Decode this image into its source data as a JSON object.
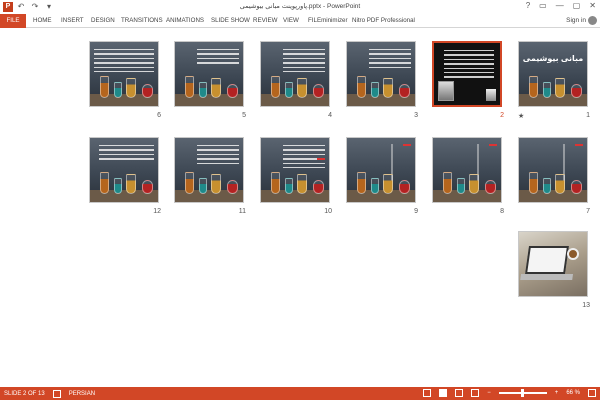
{
  "app": {
    "icon_letter": "P",
    "title": "پاورپوینت مبانی بیوشیمی.pptx - PowerPoint",
    "qat": [
      "↶",
      "↷",
      "▾"
    ]
  },
  "window_controls": [
    "?",
    "▭",
    "—",
    "▢",
    "✕"
  ],
  "ribbon": {
    "tabs": [
      "FILE",
      "HOME",
      "INSERT",
      "DESIGN",
      "TRANSITIONS",
      "ANIMATIONS",
      "SLIDE SHOW",
      "REVIEW",
      "VIEW",
      "FILEminimizer",
      "Nitro PDF Professional"
    ],
    "signin": "Sign in"
  },
  "slides": [
    {
      "num": "1",
      "title": "مبانی بیوشیمی",
      "star": "★"
    },
    {
      "num": "2"
    },
    {
      "num": "3"
    },
    {
      "num": "4"
    },
    {
      "num": "5"
    },
    {
      "num": "6"
    },
    {
      "num": "7"
    },
    {
      "num": "8"
    },
    {
      "num": "9"
    },
    {
      "num": "10"
    },
    {
      "num": "11"
    },
    {
      "num": "12"
    },
    {
      "num": "13"
    }
  ],
  "selected_slide": 2,
  "status": {
    "slide_info": "SLIDE 2 OF 13",
    "language": "PERSIAN",
    "zoom": "66 %",
    "zoom_minus": "−",
    "zoom_plus": "+"
  },
  "colors": {
    "accent": "#d24726"
  }
}
